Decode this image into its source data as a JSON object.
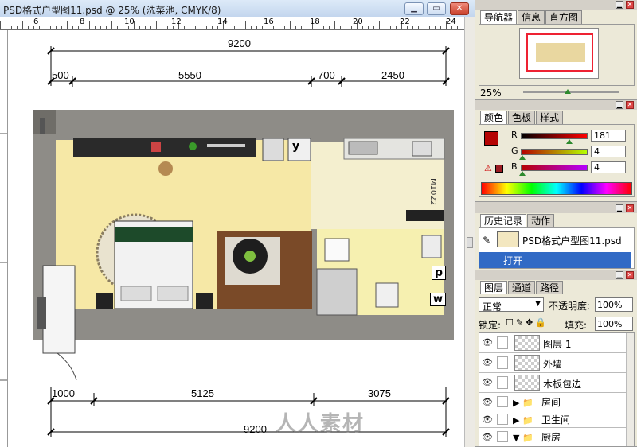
{
  "window": {
    "title": "PSD格式户型图11.psd @ 25% (洗菜池, CMYK/8)",
    "minimize": "▁",
    "restore": "▭",
    "close": "✕"
  },
  "ruler": {
    "top_numbers": [
      "6",
      "8",
      "10",
      "12",
      "14",
      "16",
      "18",
      "20",
      "22",
      "24"
    ]
  },
  "dimensions": {
    "top_total": "9200",
    "top_segments": [
      "500",
      "5550",
      "700",
      "2450"
    ],
    "bottom_segments": [
      "1000",
      "5125",
      "3075"
    ],
    "bottom_total": "9200",
    "door_label": "M1022"
  },
  "plan_labels": {
    "y": "y",
    "p": "p",
    "w": "w"
  },
  "watermark": "人人素材",
  "navigator": {
    "tabs": [
      "导航器",
      "信息",
      "直方图"
    ],
    "zoom": "25%"
  },
  "color": {
    "tabs": [
      "颜色",
      "色板",
      "样式"
    ],
    "channels": [
      {
        "label": "R",
        "value": "181"
      },
      {
        "label": "G",
        "value": "4"
      },
      {
        "label": "B",
        "value": "4"
      }
    ],
    "foreground": "#b50404"
  },
  "history": {
    "tabs": [
      "历史记录",
      "动作"
    ],
    "snapshot": "PSD格式户型图11.psd",
    "step": "打开"
  },
  "layers": {
    "tabs": [
      "图层",
      "通道",
      "路径"
    ],
    "blend_mode": "正常",
    "opacity_label": "不透明度:",
    "opacity": "100%",
    "lock_label": "锁定:",
    "fill_label": "填充:",
    "fill": "100%",
    "items": [
      {
        "name": "图层 1",
        "type": "layer"
      },
      {
        "name": "外墙",
        "type": "layer"
      },
      {
        "name": "木板包边",
        "type": "layer"
      },
      {
        "name": "房间",
        "type": "group"
      },
      {
        "name": "卫生间",
        "type": "group"
      },
      {
        "name": "厨房",
        "type": "group"
      }
    ]
  }
}
